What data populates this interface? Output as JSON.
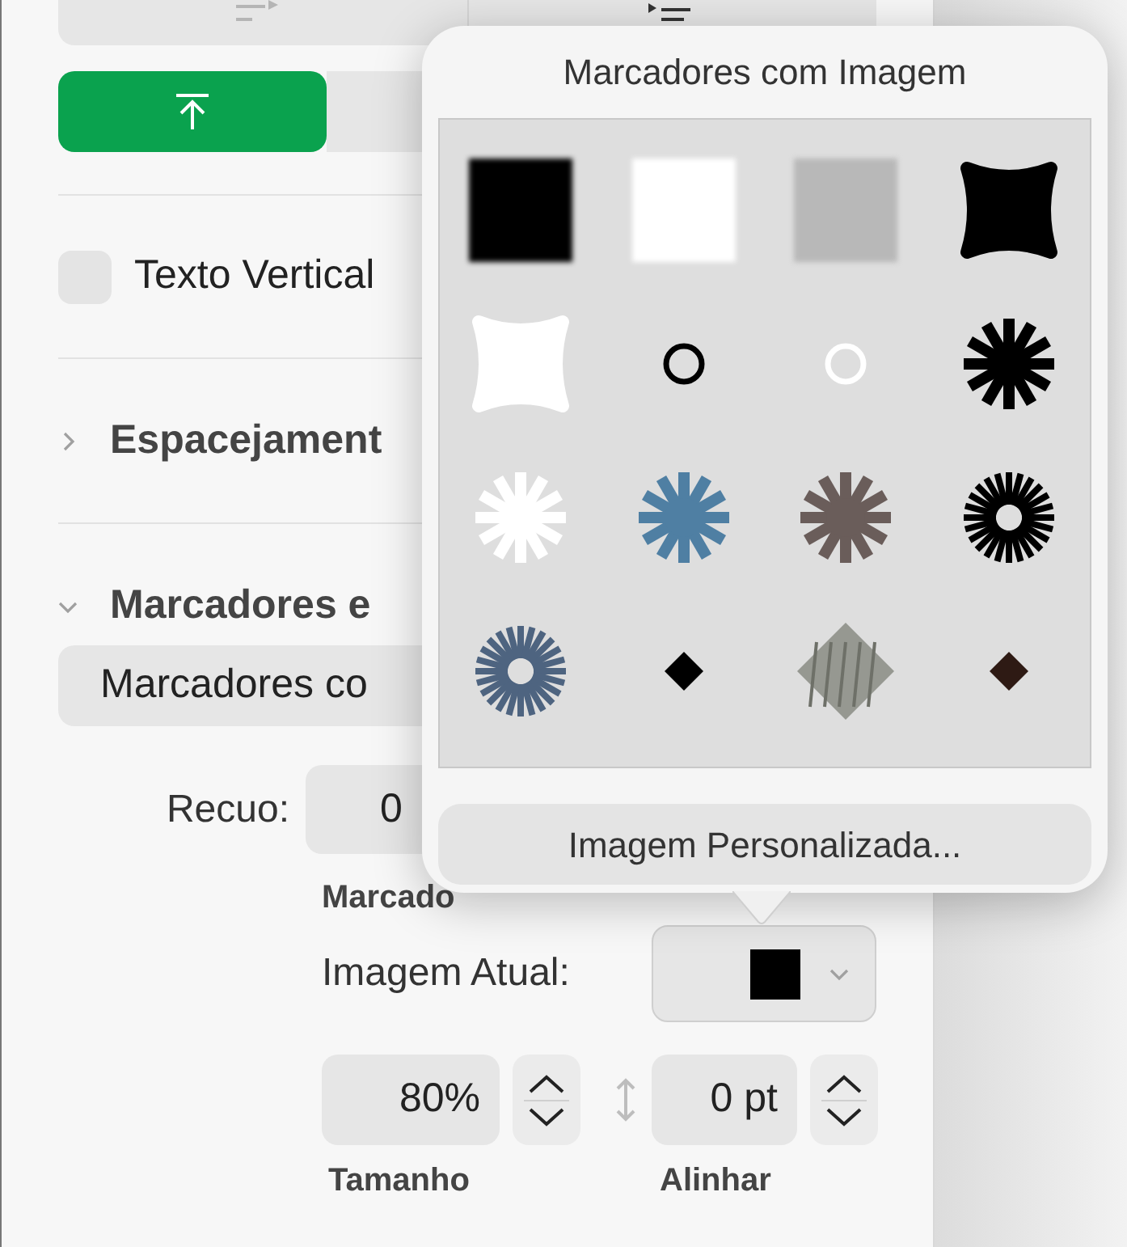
{
  "alignment_segments": [
    {
      "selected": true
    },
    {
      "selected": false
    }
  ],
  "vertical_text": {
    "label": "Texto Vertical",
    "checked": false
  },
  "sections": [
    {
      "title": "Espacejament",
      "expanded": false
    },
    {
      "title": "Marcadores e",
      "expanded": true
    }
  ],
  "bullet_style": {
    "value": "Marcadores co"
  },
  "indent": {
    "label": "Recuo:",
    "bullet_value": "0",
    "bullet_caption": "Marcado"
  },
  "current_image": {
    "label": "Imagem Atual:"
  },
  "size": {
    "value": "80%",
    "caption": "Tamanho"
  },
  "align": {
    "value": "0 pt",
    "caption": "Alinhar"
  },
  "popover": {
    "title": "Marcadores com Imagem",
    "images": [
      {
        "kind": "square",
        "color": "#000000"
      },
      {
        "kind": "square",
        "color": "#ffffff"
      },
      {
        "kind": "square",
        "color": "#b8b8b8"
      },
      {
        "kind": "blob",
        "color": "#000000"
      },
      {
        "kind": "blob",
        "color": "#ffffff"
      },
      {
        "kind": "ring",
        "color": "#000000"
      },
      {
        "kind": "ring",
        "color": "#ffffff"
      },
      {
        "kind": "star",
        "color": "#000000"
      },
      {
        "kind": "star",
        "color": "#ffffff"
      },
      {
        "kind": "star",
        "color": "#4f7fa3"
      },
      {
        "kind": "star",
        "color": "#6a5d5a"
      },
      {
        "kind": "sunburst",
        "color": "#000000"
      },
      {
        "kind": "sunburst",
        "color": "#4e6480"
      },
      {
        "kind": "diamond",
        "color": "#000000"
      },
      {
        "kind": "scribble",
        "color": "#8a8c84"
      },
      {
        "kind": "diamond",
        "color": "#2e1a14"
      }
    ],
    "button": "Imagem Personalizada..."
  }
}
